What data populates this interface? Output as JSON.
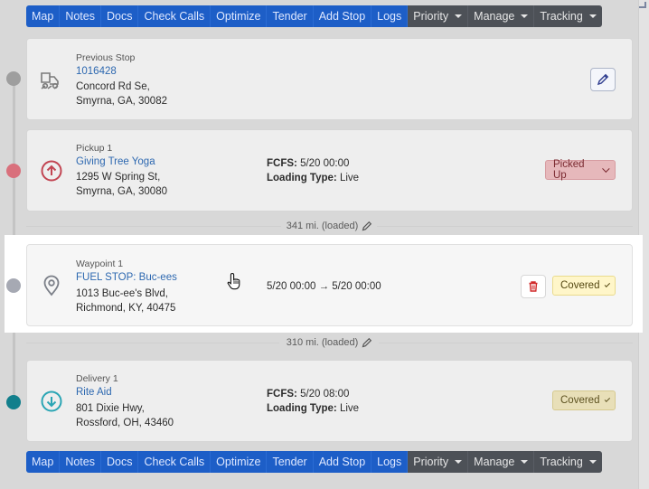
{
  "toolbar": {
    "buttons": [
      {
        "label": "Map"
      },
      {
        "label": "Notes"
      },
      {
        "label": "Docs"
      },
      {
        "label": "Check Calls"
      },
      {
        "label": "Optimize"
      },
      {
        "label": "Tender"
      },
      {
        "label": "Add Stop"
      },
      {
        "label": "Logs"
      }
    ],
    "dropdowns": [
      {
        "label": "Priority"
      },
      {
        "label": "Manage"
      },
      {
        "label": "Tracking"
      }
    ]
  },
  "stops": {
    "previous": {
      "kind": "Previous Stop",
      "link": "1016428",
      "address_line1": "Concord Rd Se,",
      "address_line2": "Smyrna, GA, 30082",
      "icon": "truck-icon",
      "dot_color": "#9e9e9e"
    },
    "pickup": {
      "kind": "Pickup 1",
      "link": "Giving Tree Yoga",
      "address_line1": "1295 W Spring St,",
      "address_line2": "Smyrna, GA, 30080",
      "fcfs_label": "FCFS:",
      "fcfs_value": "5/20 00:00",
      "loading_label": "Loading Type:",
      "loading_value": "Live",
      "status": "Picked Up",
      "icon": "arrow-up-circle-icon",
      "dot_color": "#d9707c",
      "icon_color": "#c24552"
    },
    "waypoint": {
      "kind": "Waypoint 1",
      "link": "FUEL STOP: Buc-ees",
      "address_line1": "1013 Buc-ee's Blvd,",
      "address_line2": "Richmond, KY, 40475",
      "time_from": "5/20 00:00",
      "arrow": "→",
      "time_to": "5/20 00:00",
      "status": "Covered",
      "icon": "map-pin-icon",
      "dot_color": "#a6a9b3",
      "icon_color": "#7b7f88"
    },
    "delivery": {
      "kind": "Delivery 1",
      "link": "Rite Aid",
      "address_line1": "801 Dixie Hwy,",
      "address_line2": "Rossford, OH, 43460",
      "fcfs_label": "FCFS:",
      "fcfs_value": "5/20 08:00",
      "loading_label": "Loading Type:",
      "loading_value": "Live",
      "status": "Covered",
      "icon": "arrow-down-circle-icon",
      "dot_color": "#127f8c",
      "icon_color": "#2aa5b4"
    }
  },
  "mileage": {
    "leg1": "341 mi. (loaded)",
    "leg2": "310 mi. (loaded)"
  },
  "colors": {
    "toolbar_blue": "#1d5ec7",
    "toolbar_dark": "#4d5157",
    "link_blue": "#2d68b0"
  }
}
